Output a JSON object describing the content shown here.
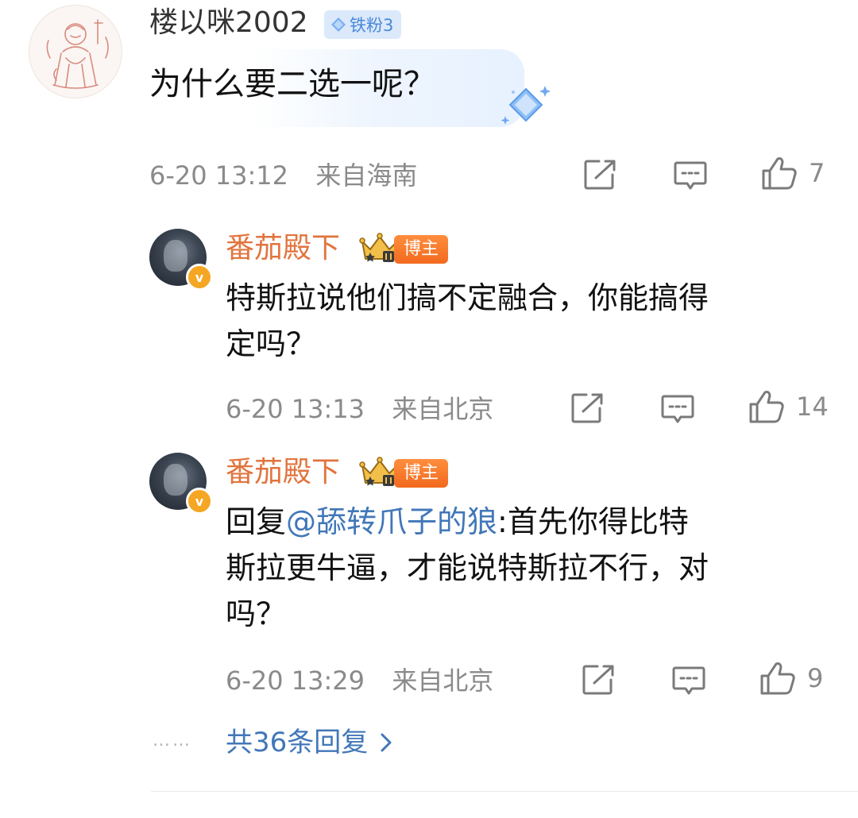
{
  "comment": {
    "username": "楼以咪2002",
    "fan_badge": "铁粉3",
    "text": "为什么要二选一呢？",
    "time": "6-20 13:12",
    "location": "来自海南",
    "likes": "7"
  },
  "replies": [
    {
      "username": "番茄殿下",
      "author_badge": "博主",
      "line1": "特斯拉说他们搞不定融合，你能搞得",
      "line2": "定吗？",
      "time": "6-20 13:13",
      "location": "来自北京",
      "likes": "14"
    },
    {
      "username": "番茄殿下",
      "author_badge": "博主",
      "reply_prefix": "回复",
      "mention": "@舔转爪子的狼",
      "line1_rest": ":首先你得比特",
      "line2": "斯拉更牛逼，才能说特斯拉不行，对",
      "line3": "吗？",
      "time": "6-20 13:29",
      "location": "来自北京",
      "likes": "9"
    }
  ],
  "footer": {
    "dots": "……",
    "more_replies": "共36条回复"
  },
  "colors": {
    "author_name": "#e1743e",
    "link_blue": "#4177b8",
    "meta_gray": "#8a8a8a",
    "author_badge_orange": "#f26a1e"
  },
  "icons": [
    "share-icon",
    "comment-icon",
    "like-icon",
    "chevron-right-icon",
    "verified-icon",
    "crown-icon",
    "diamond-icon"
  ]
}
